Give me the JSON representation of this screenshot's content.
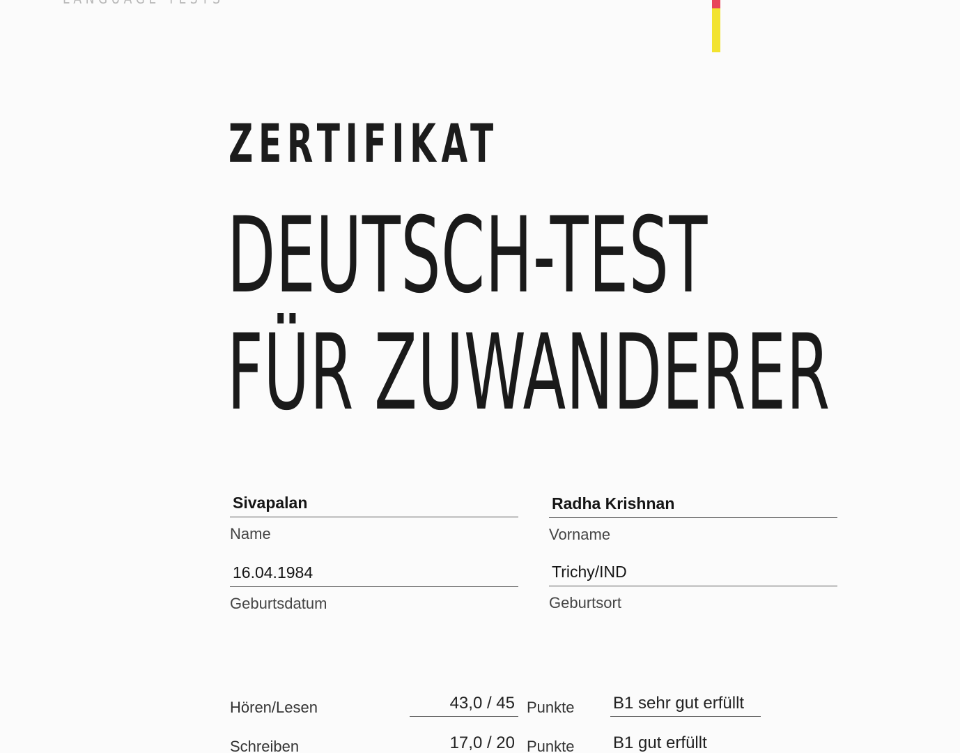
{
  "header": {
    "brand_text": "LANGUAGE TESTS",
    "flag_colors": {
      "red": "#e8455a",
      "yellow": "#f2e330"
    }
  },
  "title": {
    "kicker": "ZERTIFIKAT",
    "line1": "DEUTSCH-TEST",
    "line2": "FÜR ZUWANDERER"
  },
  "person": {
    "name_value": "Sivapalan",
    "name_label": "Name",
    "vorname_value": "Radha Krishnan",
    "vorname_label": "Vorname",
    "birthdate_value": "16.04.1984",
    "birthdate_label": "Geburtsdatum",
    "birthplace_value": "Trichy/IND",
    "birthplace_label": "Geburtsort"
  },
  "results": [
    {
      "section": "Hören/Lesen",
      "score": "43,0 / 45",
      "unit": "Punkte",
      "result": "B1 sehr gut erfüllt"
    },
    {
      "section": "Schreiben",
      "score": "17,0 / 20",
      "unit": "Punkte",
      "result": "B1 gut erfüllt"
    }
  ]
}
